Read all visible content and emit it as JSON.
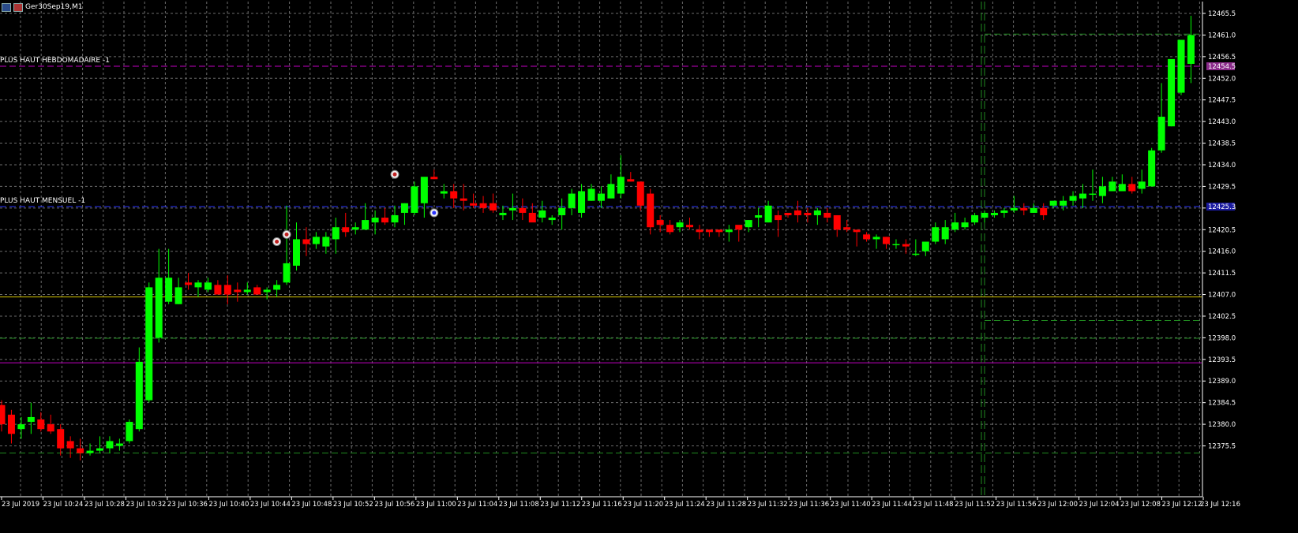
{
  "window": {
    "title": "Ger30Sep19,M1"
  },
  "colors": {
    "background": "#000000",
    "grid": "#6b6b6b",
    "bull": "#00ff00",
    "bear": "#ff0000",
    "axis_text": "#ffffff",
    "weekly_high_line": "#c000c0",
    "monthly_high_line": "#2a33ff",
    "yellow_line": "#d4c400",
    "magenta_line": "#c000c0",
    "green_dashed": "#1f8a1f"
  },
  "lines": {
    "weekly_high_label": "PLUS HAUT HEBDOMADAIRE -1",
    "monthly_high_label": "PLUS HAUT MENSUEL -1"
  },
  "chart_data": {
    "type": "candlestick",
    "symbol": "Ger30Sep19",
    "timeframe": "M1",
    "ylim": [
      12370.5,
      12465.5
    ],
    "y_ticks": [
      "12465.5",
      "12461.0",
      "12456.5",
      "12452.0",
      "12447.5",
      "12443.0",
      "12438.5",
      "12434.0",
      "12429.5",
      "12425.0",
      "12420.5",
      "12416.0",
      "12411.5",
      "12407.0",
      "12402.5",
      "12398.0",
      "12393.5",
      "12389.0",
      "12384.5",
      "12380.0",
      "12375.5"
    ],
    "x_ticks": [
      "23 Jul 2019",
      "23 Jul 10:24",
      "23 Jul 10:28",
      "23 Jul 10:32",
      "23 Jul 10:36",
      "23 Jul 10:40",
      "23 Jul 10:44",
      "23 Jul 10:48",
      "23 Jul 10:52",
      "23 Jul 10:56",
      "23 Jul 11:00",
      "23 Jul 11:04",
      "23 Jul 11:08",
      "23 Jul 11:12",
      "23 Jul 11:16",
      "23 Jul 11:20",
      "23 Jul 11:24",
      "23 Jul 11:28",
      "23 Jul 11:32",
      "23 Jul 11:36",
      "23 Jul 11:40",
      "23 Jul 11:44",
      "23 Jul 11:48",
      "23 Jul 11:52",
      "23 Jul 11:56",
      "23 Jul 12:00",
      "23 Jul 12:04",
      "23 Jul 12:08",
      "23 Jul 12:12",
      "23 Jul 12:16"
    ],
    "horizontal_lines": [
      {
        "price": 12454.5,
        "style": "dashed",
        "color": "#c000c0",
        "label": "PLUS HAUT HEBDOMADAIRE -1"
      },
      {
        "price": 12425.3,
        "style": "dashed",
        "color": "#2a33ff",
        "label": "PLUS HAUT MENSUEL -1"
      },
      {
        "price": 12406.5,
        "style": "solid",
        "color": "#d4c400"
      },
      {
        "price": 12392.8,
        "style": "solid",
        "color": "#c000c0"
      },
      {
        "price": 12397.9,
        "style": "dashed",
        "color": "#1f8a1f"
      },
      {
        "price": 12374.0,
        "style": "dashed",
        "color": "#1f8a1f"
      },
      {
        "price": 12461.2,
        "style": "dashed",
        "color": "#1f8a1f",
        "from_bar": 100
      },
      {
        "price": 12401.6,
        "style": "dashed",
        "color": "#1f8a1f",
        "from_bar": 100
      }
    ],
    "price_boxes": [
      {
        "price": 12454.5,
        "color": "#8a2a8a",
        "text": "12454.5"
      },
      {
        "price": 12425.3,
        "color": "#1a1aa0",
        "text": "12425.3"
      }
    ],
    "candles": [
      [
        12384.0,
        12385.0,
        12378.5,
        12380.0
      ],
      [
        12382.0,
        12383.0,
        12376.0,
        12378.0
      ],
      [
        12379.0,
        12381.5,
        12377.0,
        12380.0
      ],
      [
        12380.5,
        12384.5,
        12378.0,
        12381.5
      ],
      [
        12381.0,
        12382.5,
        12378.5,
        12379.0
      ],
      [
        12380.0,
        12382.0,
        12378.0,
        12378.5
      ],
      [
        12379.0,
        12380.0,
        12373.5,
        12375.0
      ],
      [
        12376.5,
        12377.5,
        12373.0,
        12375.0
      ],
      [
        12375.0,
        12377.0,
        12372.5,
        12374.0
      ],
      [
        12374.0,
        12376.0,
        12373.5,
        12374.5
      ],
      [
        12374.5,
        12377.5,
        12374.0,
        12375.0
      ],
      [
        12375.0,
        12377.5,
        12374.0,
        12376.5
      ],
      [
        12375.5,
        12377.0,
        12374.5,
        12376.0
      ],
      [
        12376.5,
        12381.0,
        12376.0,
        12380.5
      ],
      [
        12379.0,
        12396.0,
        12378.5,
        12393.0
      ],
      [
        12385.0,
        12409.5,
        12384.5,
        12408.5
      ],
      [
        12398.0,
        12416.5,
        12397.0,
        12410.5
      ],
      [
        12405.5,
        12416.5,
        12405.0,
        12410.5
      ],
      [
        12405.0,
        12410.5,
        12405.0,
        12408.5
      ],
      [
        12409.5,
        12411.5,
        12408.0,
        12409.0
      ],
      [
        12408.5,
        12410.0,
        12406.5,
        12409.5
      ],
      [
        12408.0,
        12410.5,
        12407.5,
        12409.5
      ],
      [
        12409.0,
        12410.0,
        12407.0,
        12407.0
      ],
      [
        12409.0,
        12411.0,
        12405.0,
        12407.0
      ],
      [
        12408.0,
        12409.5,
        12405.5,
        12407.5
      ],
      [
        12407.5,
        12409.5,
        12407.0,
        12408.0
      ],
      [
        12408.5,
        12409.0,
        12407.0,
        12407.0
      ],
      [
        12407.5,
        12408.5,
        12406.0,
        12408.0
      ],
      [
        12408.0,
        12410.0,
        12406.5,
        12409.0
      ],
      [
        12409.5,
        12425.5,
        12409.0,
        12413.5
      ],
      [
        12413.0,
        12422.0,
        12412.0,
        12418.5
      ],
      [
        12418.5,
        12421.0,
        12415.0,
        12417.5
      ],
      [
        12417.5,
        12420.0,
        12416.5,
        12419.0
      ],
      [
        12417.0,
        12420.0,
        12415.5,
        12419.0
      ],
      [
        12418.5,
        12423.0,
        12415.5,
        12421.0
      ],
      [
        12421.0,
        12424.0,
        12419.0,
        12420.0
      ],
      [
        12420.5,
        12422.0,
        12419.5,
        12421.0
      ],
      [
        12420.5,
        12426.0,
        12420.5,
        12422.5
      ],
      [
        12422.0,
        12424.5,
        12419.5,
        12423.0
      ],
      [
        12423.0,
        12425.0,
        12421.5,
        12422.0
      ],
      [
        12422.0,
        12425.5,
        12421.0,
        12423.5
      ],
      [
        12424.0,
        12426.0,
        12421.5,
        12426.0
      ],
      [
        12424.0,
        12430.5,
        12423.5,
        12429.5
      ],
      [
        12426.0,
        12431.0,
        12423.0,
        12431.5
      ],
      [
        12431.5,
        12433.0,
        12431.0,
        12431.0
      ],
      [
        12428.0,
        12430.0,
        12427.0,
        12428.5
      ],
      [
        12428.5,
        12430.0,
        12425.0,
        12427.0
      ],
      [
        12427.0,
        12430.0,
        12424.5,
        12426.5
      ],
      [
        12426.0,
        12428.0,
        12425.0,
        12425.5
      ],
      [
        12426.0,
        12427.5,
        12424.0,
        12425.0
      ],
      [
        12426.0,
        12428.0,
        12424.0,
        12424.5
      ],
      [
        12423.5,
        12425.5,
        12422.5,
        12424.0
      ],
      [
        12424.5,
        12428.0,
        12422.5,
        12425.0
      ],
      [
        12425.0,
        12427.0,
        12422.5,
        12424.0
      ],
      [
        12424.0,
        12426.0,
        12422.5,
        12422.0
      ],
      [
        12423.0,
        12426.5,
        12422.0,
        12424.5
      ],
      [
        12422.5,
        12423.5,
        12421.5,
        12423.0
      ],
      [
        12423.5,
        12427.0,
        12420.5,
        12425.0
      ],
      [
        12425.0,
        12429.0,
        12423.5,
        12428.0
      ],
      [
        12424.0,
        12430.0,
        12423.0,
        12428.5
      ],
      [
        12426.5,
        12430.0,
        12426.5,
        12429.0
      ],
      [
        12426.5,
        12429.5,
        12425.0,
        12428.0
      ],
      [
        12427.0,
        12432.0,
        12427.0,
        12430.0
      ],
      [
        12428.0,
        12436.0,
        12427.0,
        12431.5
      ],
      [
        12431.0,
        12432.5,
        12430.5,
        12430.5
      ],
      [
        12430.5,
        12430.5,
        12424.5,
        12425.5
      ],
      [
        12428.0,
        12429.0,
        12419.5,
        12421.0
      ],
      [
        12422.5,
        12423.5,
        12420.0,
        12421.5
      ],
      [
        12421.5,
        12422.5,
        12419.5,
        12420.0
      ],
      [
        12421.0,
        12422.5,
        12420.0,
        12422.0
      ],
      [
        12421.5,
        12423.0,
        12420.5,
        12421.0
      ],
      [
        12420.5,
        12421.5,
        12418.5,
        12420.0
      ],
      [
        12420.5,
        12420.5,
        12419.0,
        12420.0
      ],
      [
        12420.5,
        12420.5,
        12419.0,
        12420.0
      ],
      [
        12420.0,
        12421.5,
        12418.0,
        12420.5
      ],
      [
        12421.5,
        12420.5,
        12418.0,
        12420.5
      ],
      [
        12421.0,
        12422.5,
        12420.0,
        12422.5
      ],
      [
        12423.0,
        12425.0,
        12421.0,
        12423.5
      ],
      [
        12422.0,
        12426.5,
        12422.0,
        12425.5
      ],
      [
        12423.5,
        12424.5,
        12419.0,
        12422.5
      ],
      [
        12424.0,
        12423.5,
        12423.0,
        12423.5
      ],
      [
        12424.5,
        12426.5,
        12422.0,
        12423.5
      ],
      [
        12424.0,
        12425.0,
        12422.0,
        12423.5
      ],
      [
        12423.5,
        12425.0,
        12421.5,
        12424.5
      ],
      [
        12424.0,
        12425.0,
        12422.0,
        12423.0
      ],
      [
        12423.5,
        12423.5,
        12419.0,
        12420.5
      ],
      [
        12421.0,
        12422.5,
        12420.0,
        12420.5
      ],
      [
        12420.5,
        12420.5,
        12417.0,
        12420.0
      ],
      [
        12419.5,
        12420.0,
        12418.0,
        12418.5
      ],
      [
        12418.5,
        12419.5,
        12416.5,
        12419.0
      ],
      [
        12419.0,
        12419.0,
        12416.5,
        12417.5
      ],
      [
        12417.5,
        12418.5,
        12416.5,
        12417.5
      ],
      [
        12417.5,
        12418.5,
        12415.5,
        12417.0
      ],
      [
        12415.5,
        12418.5,
        12415.0,
        12415.5
      ],
      [
        12416.0,
        12418.0,
        12415.0,
        12418.0
      ],
      [
        12418.0,
        12422.0,
        12417.5,
        12421.0
      ],
      [
        12418.5,
        12422.5,
        12417.5,
        12421.0
      ],
      [
        12420.5,
        12424.0,
        12420.0,
        12422.0
      ],
      [
        12421.0,
        12423.0,
        12420.5,
        12422.0
      ],
      [
        12422.0,
        12424.0,
        12421.5,
        12423.5
      ],
      [
        12423.0,
        12424.5,
        12422.0,
        12424.0
      ],
      [
        12423.5,
        12424.5,
        12423.0,
        12424.0
      ],
      [
        12424.0,
        12425.0,
        12423.0,
        12424.5
      ],
      [
        12424.5,
        12427.5,
        12424.0,
        12425.0
      ],
      [
        12425.0,
        12426.0,
        12423.5,
        12424.5
      ],
      [
        12424.0,
        12426.0,
        12424.0,
        12425.0
      ],
      [
        12425.0,
        12426.0,
        12422.5,
        12423.5
      ],
      [
        12425.5,
        12426.5,
        12425.0,
        12426.5
      ],
      [
        12425.5,
        12427.5,
        12424.5,
        12426.5
      ],
      [
        12426.5,
        12428.5,
        12425.5,
        12427.5
      ],
      [
        12427.0,
        12430.0,
        12425.0,
        12428.0
      ],
      [
        12428.0,
        12433.0,
        12426.5,
        12428.0
      ],
      [
        12427.5,
        12431.5,
        12426.0,
        12429.5
      ],
      [
        12428.5,
        12431.5,
        12428.5,
        12430.5
      ],
      [
        12428.5,
        12432.0,
        12428.5,
        12430.0
      ],
      [
        12430.0,
        12431.5,
        12428.0,
        12428.5
      ],
      [
        12429.0,
        12433.0,
        12428.0,
        12430.5
      ],
      [
        12429.5,
        12437.5,
        12429.5,
        12437.0
      ],
      [
        12437.0,
        12451.0,
        12436.5,
        12444.0
      ],
      [
        12442.0,
        12454.0,
        12442.0,
        12456.0
      ],
      [
        12449.0,
        12460.0,
        12448.5,
        12460.0
      ],
      [
        12455.0,
        12465.0,
        12451.0,
        12461.0
      ]
    ],
    "signals": [
      {
        "bar": 28,
        "price": 12418.0,
        "kind": "sell"
      },
      {
        "bar": 29,
        "price": 12419.5,
        "kind": "sell"
      },
      {
        "bar": 40,
        "price": 12432.0,
        "kind": "sell"
      },
      {
        "bar": 44,
        "price": 12424.0,
        "kind": "buy"
      }
    ],
    "grid": true
  }
}
